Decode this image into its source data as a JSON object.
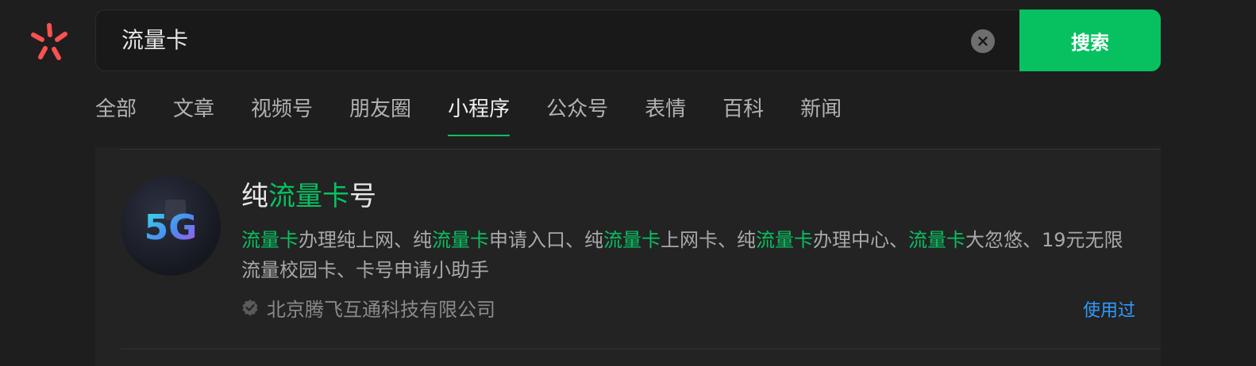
{
  "search": {
    "query": "流量卡",
    "button_label": "搜索"
  },
  "tabs": [
    {
      "label": "全部",
      "active": false
    },
    {
      "label": "文章",
      "active": false
    },
    {
      "label": "视频号",
      "active": false
    },
    {
      "label": "朋友圈",
      "active": false
    },
    {
      "label": "小程序",
      "active": true
    },
    {
      "label": "公众号",
      "active": false
    },
    {
      "label": "表情",
      "active": false
    },
    {
      "label": "百科",
      "active": false
    },
    {
      "label": "新闻",
      "active": false
    }
  ],
  "result": {
    "avatar_text": "5G",
    "title": {
      "prefix": "纯",
      "highlight": "流量卡",
      "suffix": "号"
    },
    "description": {
      "p1_hl": "流量卡",
      "p1": "办理纯上网、纯",
      "p2_hl": "流量卡",
      "p2": "申请入口、纯",
      "p3_hl": "流量卡",
      "p3": "上网卡、纯",
      "p4_hl": "流量卡",
      "p4": "办理中心、",
      "p5_hl": "流量卡",
      "p5": "大忽悠、19元无限流量校园卡、卡号申请小助手"
    },
    "publisher": "北京腾飞互通科技有限公司",
    "used_label": "使用过"
  },
  "colors": {
    "accent": "#07c160",
    "link": "#2f9bff",
    "background": "#1e1e1e"
  },
  "icons": {
    "logo": "search-logo-icon",
    "clear": "clear-icon",
    "verified": "verified-badge-icon"
  }
}
